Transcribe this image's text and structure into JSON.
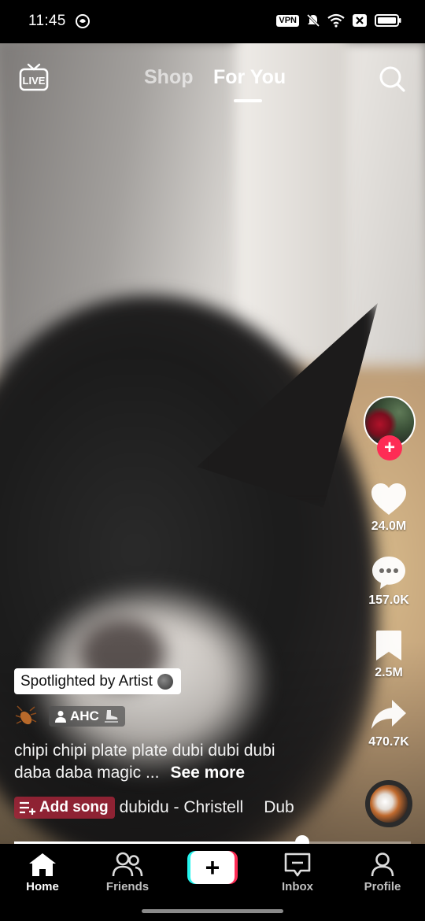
{
  "status_bar": {
    "time": "11:45",
    "vpn_label": "VPN",
    "icons": [
      "app-notification-icon",
      "mute-icon",
      "wifi-icon",
      "sim-off-icon",
      "battery-icon"
    ]
  },
  "top_nav": {
    "live_label": "LIVE",
    "tabs": [
      {
        "label": "Shop",
        "active": false
      },
      {
        "label": "For You",
        "active": true
      }
    ]
  },
  "actions": {
    "likes": "24.0M",
    "comments": "157.0K",
    "saves": "2.5M",
    "shares": "470.7K"
  },
  "video_info": {
    "spotlight_label": "Spotlighted by Artist",
    "author_name": "AHC",
    "caption": "chipi chipi plate plate dubi dubi dubi daba daba magic ...",
    "see_more": "See more",
    "add_song": "Add song",
    "song_title": "dubidu - Christell",
    "song_title_next": "Dub"
  },
  "playback": {
    "progress": 0.727
  },
  "bottom_nav": {
    "items": [
      {
        "label": "Home",
        "active": true
      },
      {
        "label": "Friends",
        "active": false
      },
      {
        "label": "Inbox",
        "active": false
      },
      {
        "label": "Profile",
        "active": false
      }
    ]
  },
  "colors": {
    "accent_pink": "#fe2c55",
    "accent_cyan": "#25f4ee"
  }
}
